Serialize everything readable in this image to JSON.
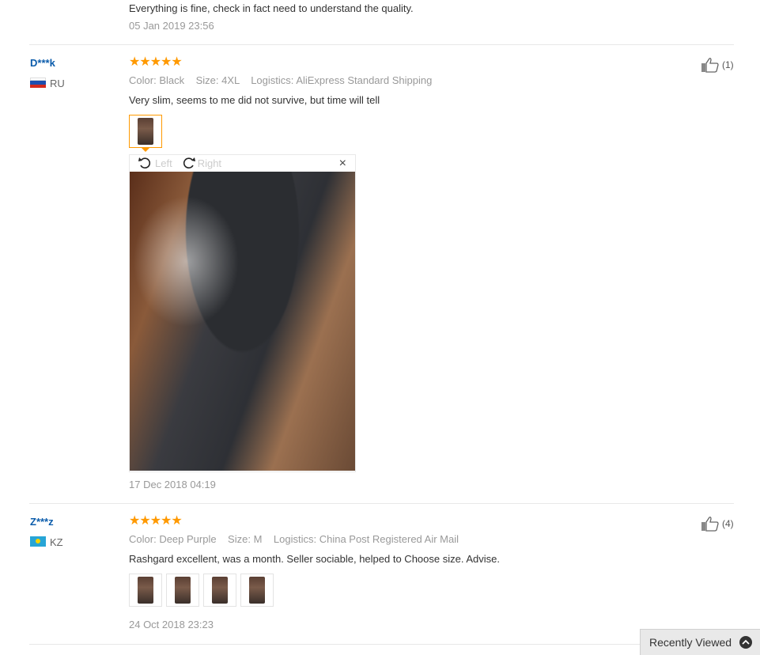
{
  "top_review": {
    "text": "Everything is fine, check in fact need to understand the quality.",
    "date": "05 Jan 2019 23:56"
  },
  "reviews": [
    {
      "user": "D***k",
      "country": "RU",
      "stars": "★★★★★",
      "color_label": "Color:",
      "color_value": "Black",
      "size_label": "Size:",
      "size_value": "4XL",
      "logistics_label": "Logistics:",
      "logistics_value": "AliExpress Standard Shipping",
      "text": "Very slim, seems to me did not survive, but time will tell",
      "likes": "(1)",
      "date": "17 Dec 2018 04:19",
      "viewer": {
        "left_label": "Left",
        "right_label": "Right",
        "close": "×"
      }
    },
    {
      "user": "Z***z",
      "country": "KZ",
      "stars": "★★★★★",
      "color_label": "Color:",
      "color_value": "Deep Purple",
      "size_label": "Size:",
      "size_value": "M",
      "logistics_label": "Logistics:",
      "logistics_value": "China Post Registered Air Mail",
      "text": "Rashgard excellent, was a month. Seller sociable, helped to Choose size. Advise.",
      "likes": "(4)",
      "date": "24 Oct 2018 23:23"
    }
  ],
  "recently_viewed": {
    "label": "Recently Viewed",
    "icon": "chevron-up-icon"
  },
  "colors": {
    "star": "#ff9900",
    "username": "#0b5cab",
    "accent": "#ff9900"
  }
}
